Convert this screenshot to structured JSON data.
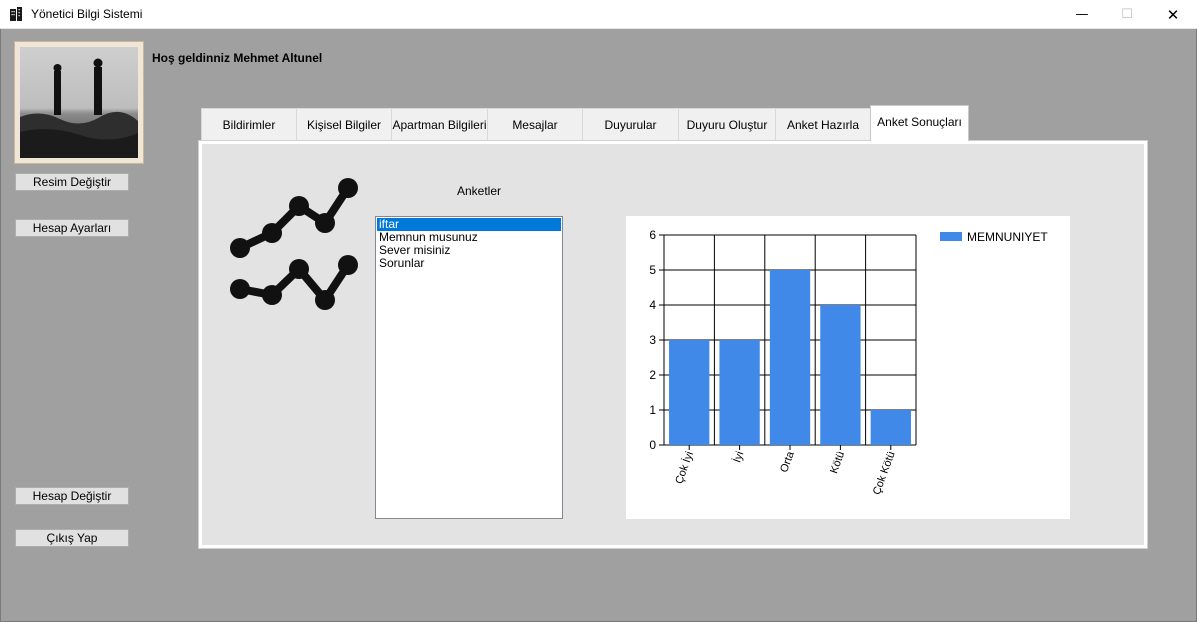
{
  "window": {
    "title": "Yönetici Bilgi Sistemi",
    "minimize_glyph": "—",
    "maximize_glyph": "☐",
    "close_glyph": "✕"
  },
  "user": {
    "welcome": "Hoş geldinniz Mehmet Altunel"
  },
  "sidebar": {
    "change_photo": "Resim Değiştir",
    "account_settings": "Hesap Ayarları",
    "switch_account": "Hesap Değiştir",
    "logout": "Çıkış Yap"
  },
  "tabs": [
    {
      "label": "Bildirimler"
    },
    {
      "label": "Kişisel Bilgiler"
    },
    {
      "label": "Apartman Bilgileri"
    },
    {
      "label": "Mesajlar"
    },
    {
      "label": "Duyurular"
    },
    {
      "label": "Duyuru Oluştur"
    },
    {
      "label": "Anket Hazırla"
    },
    {
      "label": "Anket Sonuçları"
    }
  ],
  "active_tab": "Anket Sonuçları",
  "surveys": {
    "label": "Anketler",
    "items": [
      "iftar",
      "Memnun musunuz",
      "Sever misiniz",
      "Sorunlar"
    ],
    "selected": "iftar"
  },
  "colors": {
    "bar": "#4189e8",
    "selection": "#0078d7",
    "client_bg": "#a0a0a0"
  },
  "chart_data": {
    "type": "bar",
    "categories": [
      "Çok İyi",
      "İyi",
      "Orta",
      "Kötü",
      "Çok Kötü"
    ],
    "series": [
      {
        "name": "MEMNUNIYET",
        "values": [
          3,
          3,
          5,
          4,
          1
        ]
      }
    ],
    "ylim": [
      0,
      6
    ],
    "yticks": [
      0,
      1,
      2,
      3,
      4,
      5,
      6
    ],
    "grid": true,
    "legend": "top-right"
  }
}
